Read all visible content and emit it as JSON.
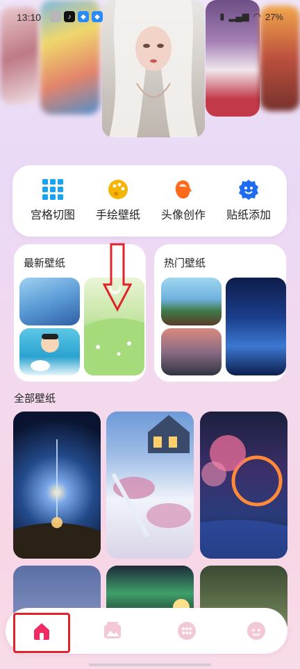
{
  "status_bar": {
    "time": "13:10",
    "battery": "27%"
  },
  "quick_tools": [
    {
      "label": "宫格切图",
      "icon": "grid-icon",
      "color": "#1aa3f0"
    },
    {
      "label": "手绘壁纸",
      "icon": "palette-icon",
      "color": "#f5b400"
    },
    {
      "label": "头像创作",
      "icon": "avatar-face-icon",
      "color": "#ff6a1a"
    },
    {
      "label": "贴纸添加",
      "icon": "sticker-face-icon",
      "color": "#1f6cf0"
    }
  ],
  "sections": {
    "latest_title": "最新壁纸",
    "hot_title": "热门壁纸",
    "all_title": "全部壁纸"
  },
  "bottom_nav": [
    {
      "name": "home",
      "icon": "home-icon",
      "active": true
    },
    {
      "name": "gallery",
      "icon": "gallery-icon",
      "active": false
    },
    {
      "name": "apps",
      "icon": "dots-grid-icon",
      "active": false
    },
    {
      "name": "profile",
      "icon": "face-icon",
      "active": false
    }
  ],
  "colors": {
    "accent": "#f02a62",
    "annotation_red": "#e0232a"
  }
}
